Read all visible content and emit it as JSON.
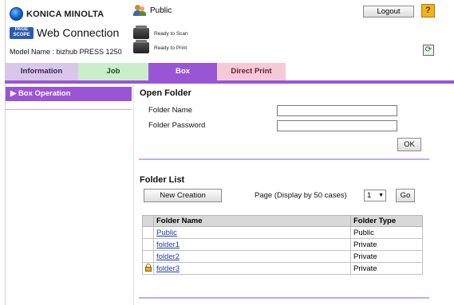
{
  "header": {
    "brand": "KONICA MINOLTA",
    "badge": "PAGE SCOPE",
    "product": "Web Connection",
    "model": "Model Name : bizhub PRESS 1250",
    "user": "Public",
    "status_scan": "Ready to Scan",
    "status_print": "Ready to Print",
    "logout_label": "Logout",
    "help_label": "?",
    "refresh_label": "⟳"
  },
  "tabs": [
    {
      "label": "Information",
      "color": "#d9c7ea"
    },
    {
      "label": "Job",
      "color": "#c9eec9"
    },
    {
      "label": "Box",
      "color": "#9a55d6",
      "active": true
    },
    {
      "label": "Direct Print",
      "color": "#f6c9d7"
    }
  ],
  "sidebar": {
    "items": [
      {
        "label": "▶ Box Operation",
        "active": true
      }
    ]
  },
  "open_folder": {
    "title": "Open Folder",
    "name_label": "Folder Name",
    "name_value": "",
    "password_label": "Folder Password",
    "password_value": "",
    "ok_label": "OK"
  },
  "folder_list": {
    "title": "Folder List",
    "new_label": "New Creation",
    "page_label": "Page (Display by 50 cases)",
    "page_value": "1",
    "go_label": "Go",
    "columns": [
      "Folder Name",
      "Folder Type"
    ],
    "rows": [
      {
        "name": "Public",
        "type": "Public",
        "locked": false
      },
      {
        "name": "folder1",
        "type": "Private",
        "locked": false
      },
      {
        "name": "folder2",
        "type": "Private",
        "locked": false
      },
      {
        "name": "folder3",
        "type": "Private",
        "locked": true
      }
    ]
  },
  "colors": {
    "accent": "#9a55d6",
    "link": "#1c3fa8"
  }
}
